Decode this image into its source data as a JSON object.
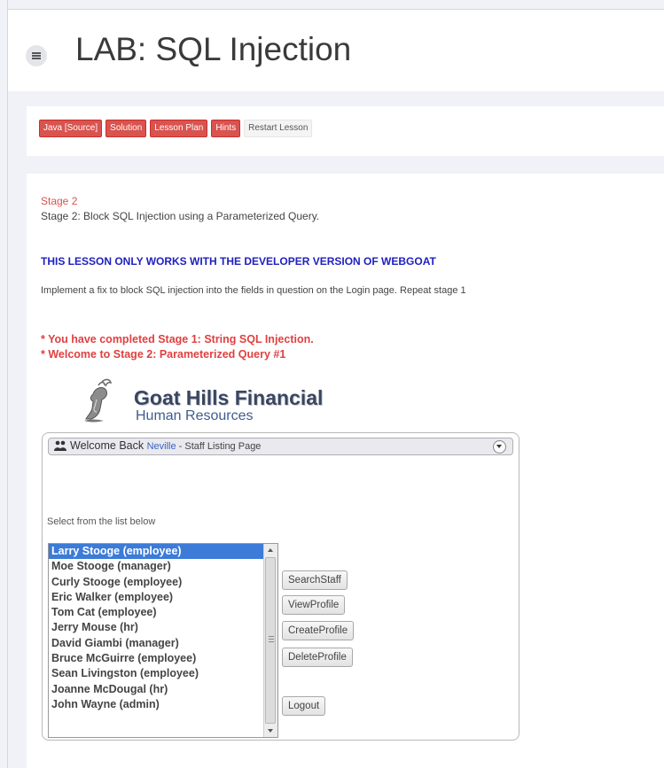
{
  "page": {
    "title": "LAB: SQL Injection"
  },
  "lesson_buttons": [
    {
      "label": "Java [Source]"
    },
    {
      "label": "Solution"
    },
    {
      "label": "Lesson Plan"
    },
    {
      "label": "Hints"
    },
    {
      "label": "Restart Lesson"
    }
  ],
  "content": {
    "stage_title": "Stage 2",
    "stage_desc": "Stage 2: Block SQL Injection using a Parameterized Query.",
    "dev_warning": "THIS LESSON ONLY WORKS WITH THE DEVELOPER VERSION OF WEBGOAT",
    "implement_text": "Implement a fix to block SQL injection into the fields in question on the Login page. Repeat stage 1",
    "message_1": "* You have completed Stage 1: String SQL Injection.",
    "message_2": "* Welcome to Stage 2: Parameterized Query #1"
  },
  "app": {
    "brand_name": "Goat Hills Financial",
    "brand_sub": "Human Resources",
    "welcome_prefix": "Welcome Back ",
    "welcome_user": "Neville",
    "welcome_suffix": " - Staff Listing Page",
    "select_label": "Select from the list below",
    "staff": [
      "Larry Stooge (employee)",
      "Moe Stooge (manager)",
      "Curly Stooge (employee)",
      "Eric Walker (employee)",
      "Tom Cat (employee)",
      "Jerry Mouse (hr)",
      "David Giambi (manager)",
      "Bruce McGuirre (employee)",
      "Sean Livingston (employee)",
      "Joanne McDougal (hr)",
      "John Wayne (admin)"
    ],
    "buttons": {
      "search": "SearchStaff",
      "view": "ViewProfile",
      "create": "CreateProfile",
      "delete": "DeleteProfile",
      "logout": "Logout"
    }
  },
  "colors": {
    "accent_red": "#d9534f",
    "warning_blue": "#2020c0",
    "selected_blue": "#3c7bd8"
  }
}
